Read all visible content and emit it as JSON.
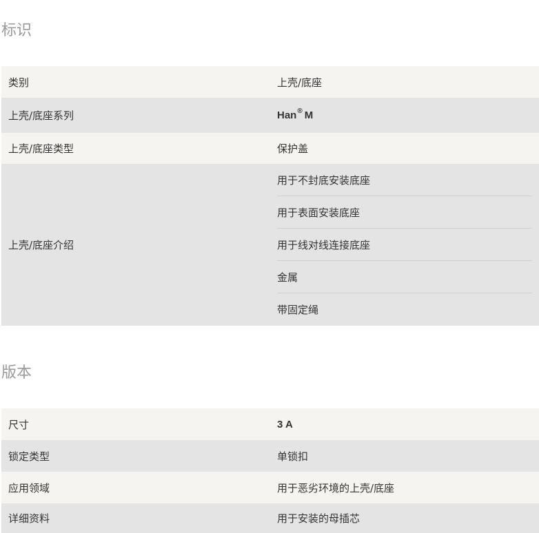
{
  "sections": {
    "identification": {
      "title": "标识",
      "rows": {
        "category": {
          "label": "类别",
          "value": "上壳/底座"
        },
        "series": {
          "label": "上壳/底座系列",
          "value_main": "Han",
          "value_sup": "®",
          "value_suffix": "M"
        },
        "type": {
          "label": "上壳/底座类型",
          "value": "保护盖"
        },
        "description": {
          "label": "上壳/底座介绍",
          "values": [
            "用于不封底安装底座",
            "用于表面安装底座",
            "用于线对线连接底座",
            "金属",
            "带固定绳"
          ]
        }
      }
    },
    "version": {
      "title": "版本",
      "rows": {
        "size": {
          "label": "尺寸",
          "value": "3 A"
        },
        "locking": {
          "label": "锁定类型",
          "value": "单锁扣"
        },
        "application": {
          "label": "应用领域",
          "value": "用于恶劣环境的上壳/底座"
        },
        "details": {
          "label": "详细资料",
          "value": "用于安装的母插芯"
        }
      }
    }
  }
}
